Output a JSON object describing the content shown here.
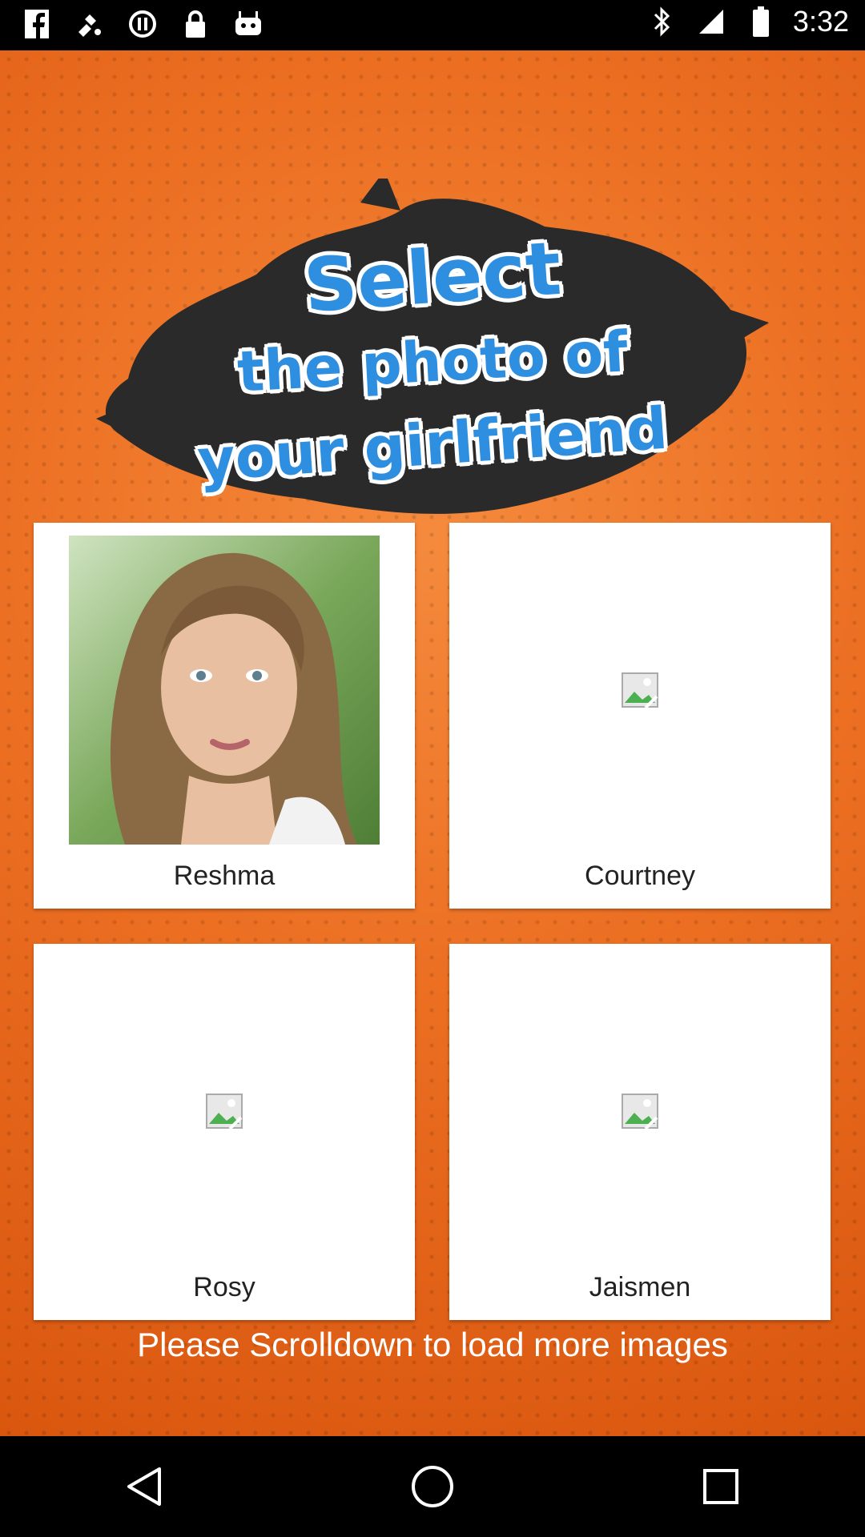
{
  "status_bar": {
    "time": "3:32",
    "icons": [
      "facebook-icon",
      "fake-gps-icon",
      "sync-icon",
      "lock-icon",
      "android-icon",
      "bluetooth-icon",
      "signal-icon",
      "battery-icon"
    ]
  },
  "banner": {
    "line1": "Select",
    "line2": "the photo of",
    "line3": "your girlfriend"
  },
  "cards": [
    {
      "name": "Reshma",
      "has_photo": true
    },
    {
      "name": "Courtney",
      "has_photo": false
    },
    {
      "name": "Rosy",
      "has_photo": false
    },
    {
      "name": "Jaismen",
      "has_photo": false
    }
  ],
  "scroll_hint": "Please Scrolldown to load more images",
  "nav": {
    "back": "back-icon",
    "home": "home-icon",
    "recents": "recents-icon"
  },
  "colors": {
    "background": "#ec6f22",
    "title_blue": "#2e8ee0"
  }
}
